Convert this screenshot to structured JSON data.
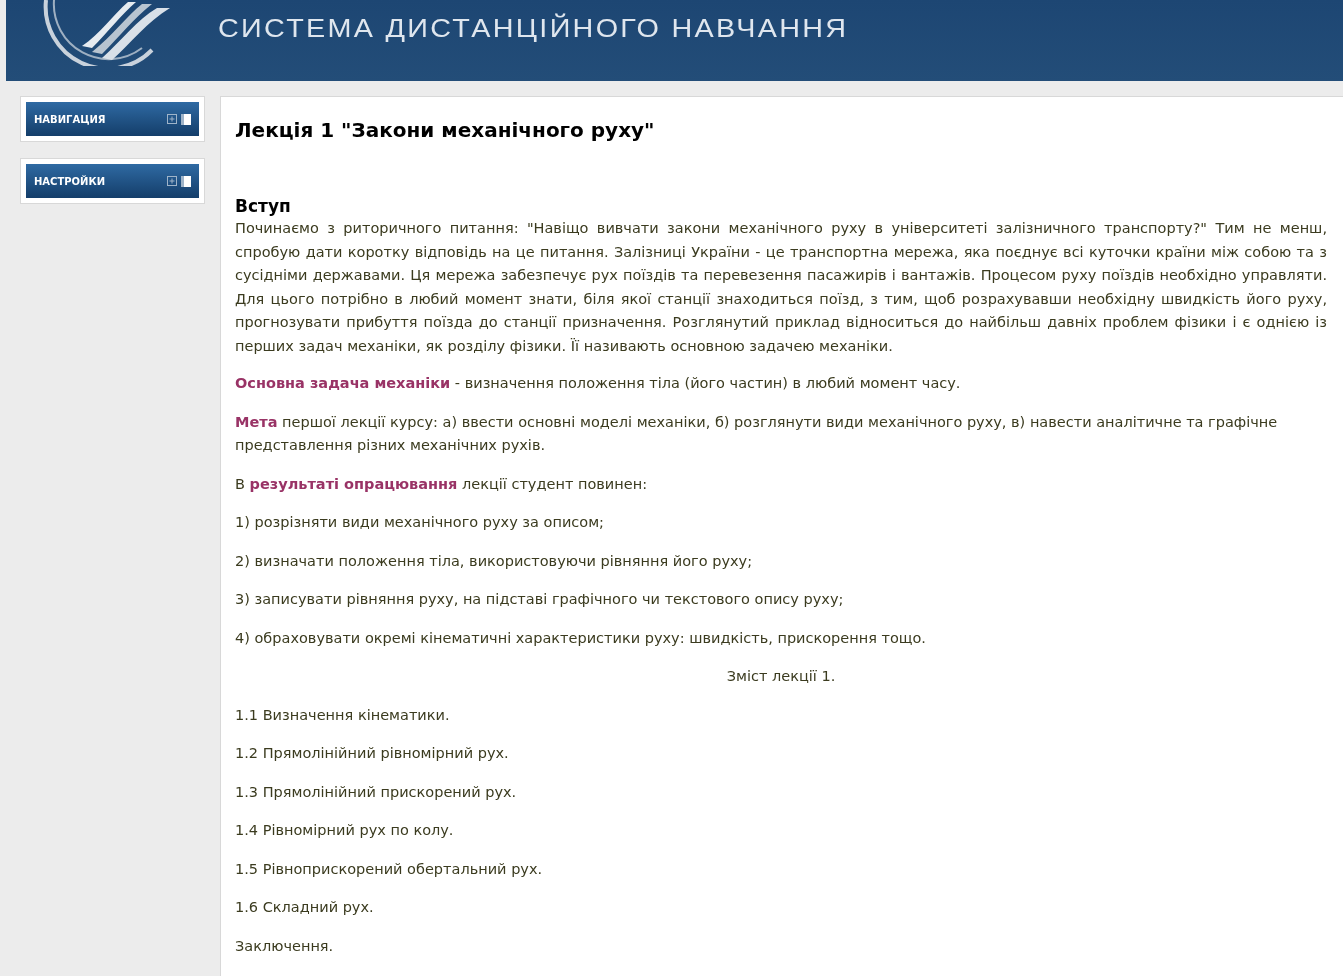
{
  "header": {
    "title": "СИСТЕМА ДИСТАНЦІЙНОГО НАВЧАННЯ"
  },
  "sidebar": {
    "blocks": [
      {
        "title": "НАВИГАЦИЯ"
      },
      {
        "title": "НАСТРОЙКИ"
      }
    ]
  },
  "content": {
    "title": "Лекція 1 \"Закони механічного руху\"",
    "section": "Вступ",
    "paragraphs": [
      {
        "kind": "justified",
        "text": "Починаємо з риторичного питання: \"Навіщо вивчати закони механічного руху в університеті залізничного транспорту?\" Тим не менш, спробую дати коротку відповідь на це питання. Залізниці України - це транспортна мережа, яка поєднує всі куточки країни між собою та з сусідніми державами. Ця мережа забезпечує рух поїздів та перевезення пасажирів і вантажів. Процесом руху поїздів необхідно управляти. Для цього потрібно в любий момент знати, біля якої станції знаходиться поїзд, з тим, щоб розрахувавши необхідну швидкість його руху, прогнозувати прибуття поїзда до станції призначення. Розглянутий приклад відноситься до найбільш давніх проблем фізики і є однією із перших задач механіки, як розділу фізики. Її називають основною задачею механіки."
      },
      {
        "kind": "plain",
        "text": "**Основна задача механіки** - визначення положення тіла (його частин) в любий момент часу."
      },
      {
        "kind": "plain",
        "text": "**Мета** першої лекції курсу: а) ввести основні моделі механіки, б) розглянути види механічного руху, в) навести аналітичне та графічне представлення різних механічних рухів."
      },
      {
        "kind": "plain",
        "text": "В **результаті опрацювання** лекції студент повинен:"
      },
      {
        "kind": "plain",
        "text": "1) розрізняти  види механічного руху за описом;"
      },
      {
        "kind": "plain",
        "text": "2) визначати положення тіла, використовуючи рівняння його руху;"
      },
      {
        "kind": "plain",
        "text": "3) записувати рівняння руху, на підставі графічного чи текстового опису руху;"
      },
      {
        "kind": "plain",
        "text": "4) обраховувати окремі кінематичні характеристики руху: швидкість, прискорення тощо."
      },
      {
        "kind": "centered",
        "text": "Зміст лекції 1."
      },
      {
        "kind": "plain",
        "text": "1.1 Визначення кінематики."
      },
      {
        "kind": "plain",
        "text": "1.2 Прямолінійний рівномірний рух."
      },
      {
        "kind": "plain",
        "text": "1.3 Прямолінійний прискорений рух."
      },
      {
        "kind": "plain",
        "text": "1.4 Рівномірний рух по колу."
      },
      {
        "kind": "plain",
        "text": "1.5 Рівноприскорений обертальний рух."
      },
      {
        "kind": "plain",
        "text": "1.6 Складний рух."
      },
      {
        "kind": "plain",
        "text": "Заключення."
      }
    ]
  }
}
